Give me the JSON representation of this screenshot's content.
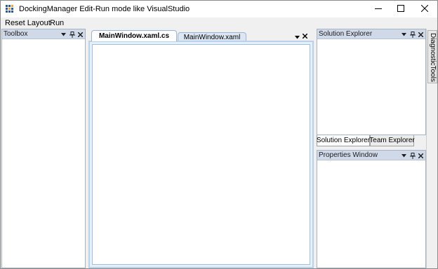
{
  "window": {
    "title": "DockingManager Edit-Run mode like VisualStudio"
  },
  "icons": {
    "app": "app-grid-icon",
    "minimize": "minimize-icon",
    "maximize": "maximize-icon",
    "close": "close-icon",
    "dropdown": "chevron-down-icon",
    "pin": "pin-icon",
    "panel_close": "close-icon"
  },
  "menu": {
    "items": [
      {
        "label": "Reset Layout"
      },
      {
        "label": "Run"
      }
    ]
  },
  "toolbox": {
    "title": "Toolbox"
  },
  "documents": {
    "tabs": [
      {
        "label": "MainWindow.xaml.cs",
        "active": true
      },
      {
        "label": "MainWindow.xaml",
        "active": false
      }
    ]
  },
  "solution_explorer": {
    "title": "Solution Explorer",
    "bottom_tabs": [
      {
        "label": "Solution Explorer",
        "active": true
      },
      {
        "label": "Team Explorer",
        "active": false
      }
    ]
  },
  "properties_window": {
    "title": "Properties Window"
  },
  "auto_hide": {
    "label": "DiagnosticTools"
  },
  "colors": {
    "panel_header": "#cfd9e8",
    "doc_border": "#b9d2ea",
    "active_tab": "#ffffff",
    "inactive_tab": "#dce7f3"
  }
}
